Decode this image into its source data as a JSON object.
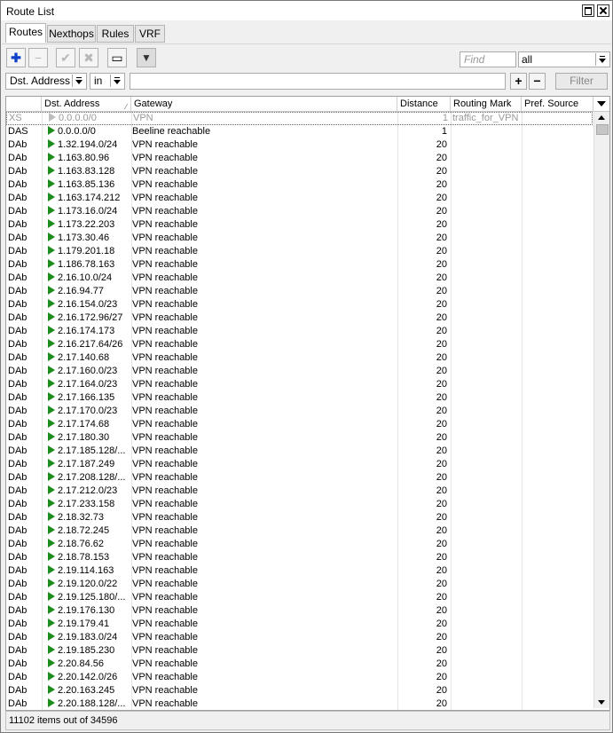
{
  "window": {
    "title": "Route List"
  },
  "tabs": [
    {
      "label": "Routes",
      "active": true
    },
    {
      "label": "Nexthops",
      "active": false
    },
    {
      "label": "Rules",
      "active": false
    },
    {
      "label": "VRF",
      "active": false
    }
  ],
  "toolbar": {
    "buttons": [
      {
        "icon": "plus-icon",
        "glyph": "✚",
        "enabled": true
      },
      {
        "icon": "minus-icon",
        "glyph": "−",
        "enabled": false
      },
      {
        "icon": "check-icon",
        "glyph": "✔",
        "enabled": false
      },
      {
        "icon": "cross-icon",
        "glyph": "✖",
        "enabled": false
      },
      {
        "icon": "comment-icon",
        "glyph": "▭",
        "enabled": true
      },
      {
        "icon": "filter-icon",
        "glyph": "▼",
        "enabled": true
      }
    ],
    "find_placeholder": "Find",
    "scope_value": "all"
  },
  "filter": {
    "field": "Dst. Address",
    "operator": "in",
    "value": "",
    "add_label": "+",
    "remove_label": "−",
    "button_label": "Filter"
  },
  "columns": {
    "flags": "",
    "dst": "Dst. Address",
    "gateway": "Gateway",
    "distance": "Distance",
    "routing_mark": "Routing Mark",
    "pref_source": "Pref. Source"
  },
  "rows": [
    {
      "flags": "XS",
      "dst": "0.0.0.0/0",
      "gateway": "VPN",
      "distance": "1",
      "mark": "traffic_for_VPN",
      "pref": "",
      "disabled": true,
      "selected": true
    },
    {
      "flags": "DAS",
      "dst": "0.0.0.0/0",
      "gateway": "Beeline reachable",
      "distance": "1",
      "mark": "",
      "pref": ""
    },
    {
      "flags": "DAb",
      "dst": "1.32.194.0/24",
      "gateway": "VPN reachable",
      "distance": "20",
      "mark": "",
      "pref": ""
    },
    {
      "flags": "DAb",
      "dst": "1.163.80.96",
      "gateway": "VPN reachable",
      "distance": "20",
      "mark": "",
      "pref": ""
    },
    {
      "flags": "DAb",
      "dst": "1.163.83.128",
      "gateway": "VPN reachable",
      "distance": "20",
      "mark": "",
      "pref": ""
    },
    {
      "flags": "DAb",
      "dst": "1.163.85.136",
      "gateway": "VPN reachable",
      "distance": "20",
      "mark": "",
      "pref": ""
    },
    {
      "flags": "DAb",
      "dst": "1.163.174.212",
      "gateway": "VPN reachable",
      "distance": "20",
      "mark": "",
      "pref": ""
    },
    {
      "flags": "DAb",
      "dst": "1.173.16.0/24",
      "gateway": "VPN reachable",
      "distance": "20",
      "mark": "",
      "pref": ""
    },
    {
      "flags": "DAb",
      "dst": "1.173.22.203",
      "gateway": "VPN reachable",
      "distance": "20",
      "mark": "",
      "pref": ""
    },
    {
      "flags": "DAb",
      "dst": "1.173.30.46",
      "gateway": "VPN reachable",
      "distance": "20",
      "mark": "",
      "pref": ""
    },
    {
      "flags": "DAb",
      "dst": "1.179.201.18",
      "gateway": "VPN reachable",
      "distance": "20",
      "mark": "",
      "pref": ""
    },
    {
      "flags": "DAb",
      "dst": "1.186.78.163",
      "gateway": "VPN reachable",
      "distance": "20",
      "mark": "",
      "pref": ""
    },
    {
      "flags": "DAb",
      "dst": "2.16.10.0/24",
      "gateway": "VPN reachable",
      "distance": "20",
      "mark": "",
      "pref": ""
    },
    {
      "flags": "DAb",
      "dst": "2.16.94.77",
      "gateway": "VPN reachable",
      "distance": "20",
      "mark": "",
      "pref": ""
    },
    {
      "flags": "DAb",
      "dst": "2.16.154.0/23",
      "gateway": "VPN reachable",
      "distance": "20",
      "mark": "",
      "pref": ""
    },
    {
      "flags": "DAb",
      "dst": "2.16.172.96/27",
      "gateway": "VPN reachable",
      "distance": "20",
      "mark": "",
      "pref": ""
    },
    {
      "flags": "DAb",
      "dst": "2.16.174.173",
      "gateway": "VPN reachable",
      "distance": "20",
      "mark": "",
      "pref": ""
    },
    {
      "flags": "DAb",
      "dst": "2.16.217.64/26",
      "gateway": "VPN reachable",
      "distance": "20",
      "mark": "",
      "pref": ""
    },
    {
      "flags": "DAb",
      "dst": "2.17.140.68",
      "gateway": "VPN reachable",
      "distance": "20",
      "mark": "",
      "pref": ""
    },
    {
      "flags": "DAb",
      "dst": "2.17.160.0/23",
      "gateway": "VPN reachable",
      "distance": "20",
      "mark": "",
      "pref": ""
    },
    {
      "flags": "DAb",
      "dst": "2.17.164.0/23",
      "gateway": "VPN reachable",
      "distance": "20",
      "mark": "",
      "pref": ""
    },
    {
      "flags": "DAb",
      "dst": "2.17.166.135",
      "gateway": "VPN reachable",
      "distance": "20",
      "mark": "",
      "pref": ""
    },
    {
      "flags": "DAb",
      "dst": "2.17.170.0/23",
      "gateway": "VPN reachable",
      "distance": "20",
      "mark": "",
      "pref": ""
    },
    {
      "flags": "DAb",
      "dst": "2.17.174.68",
      "gateway": "VPN reachable",
      "distance": "20",
      "mark": "",
      "pref": ""
    },
    {
      "flags": "DAb",
      "dst": "2.17.180.30",
      "gateway": "VPN reachable",
      "distance": "20",
      "mark": "",
      "pref": ""
    },
    {
      "flags": "DAb",
      "dst": "2.17.185.128/...",
      "gateway": "VPN reachable",
      "distance": "20",
      "mark": "",
      "pref": ""
    },
    {
      "flags": "DAb",
      "dst": "2.17.187.249",
      "gateway": "VPN reachable",
      "distance": "20",
      "mark": "",
      "pref": ""
    },
    {
      "flags": "DAb",
      "dst": "2.17.208.128/...",
      "gateway": "VPN reachable",
      "distance": "20",
      "mark": "",
      "pref": ""
    },
    {
      "flags": "DAb",
      "dst": "2.17.212.0/23",
      "gateway": "VPN reachable",
      "distance": "20",
      "mark": "",
      "pref": ""
    },
    {
      "flags": "DAb",
      "dst": "2.17.233.158",
      "gateway": "VPN reachable",
      "distance": "20",
      "mark": "",
      "pref": ""
    },
    {
      "flags": "DAb",
      "dst": "2.18.32.73",
      "gateway": "VPN reachable",
      "distance": "20",
      "mark": "",
      "pref": ""
    },
    {
      "flags": "DAb",
      "dst": "2.18.72.245",
      "gateway": "VPN reachable",
      "distance": "20",
      "mark": "",
      "pref": ""
    },
    {
      "flags": "DAb",
      "dst": "2.18.76.62",
      "gateway": "VPN reachable",
      "distance": "20",
      "mark": "",
      "pref": ""
    },
    {
      "flags": "DAb",
      "dst": "2.18.78.153",
      "gateway": "VPN reachable",
      "distance": "20",
      "mark": "",
      "pref": ""
    },
    {
      "flags": "DAb",
      "dst": "2.19.114.163",
      "gateway": "VPN reachable",
      "distance": "20",
      "mark": "",
      "pref": ""
    },
    {
      "flags": "DAb",
      "dst": "2.19.120.0/22",
      "gateway": "VPN reachable",
      "distance": "20",
      "mark": "",
      "pref": ""
    },
    {
      "flags": "DAb",
      "dst": "2.19.125.180/...",
      "gateway": "VPN reachable",
      "distance": "20",
      "mark": "",
      "pref": ""
    },
    {
      "flags": "DAb",
      "dst": "2.19.176.130",
      "gateway": "VPN reachable",
      "distance": "20",
      "mark": "",
      "pref": ""
    },
    {
      "flags": "DAb",
      "dst": "2.19.179.41",
      "gateway": "VPN reachable",
      "distance": "20",
      "mark": "",
      "pref": ""
    },
    {
      "flags": "DAb",
      "dst": "2.19.183.0/24",
      "gateway": "VPN reachable",
      "distance": "20",
      "mark": "",
      "pref": ""
    },
    {
      "flags": "DAb",
      "dst": "2.19.185.230",
      "gateway": "VPN reachable",
      "distance": "20",
      "mark": "",
      "pref": ""
    },
    {
      "flags": "DAb",
      "dst": "2.20.84.56",
      "gateway": "VPN reachable",
      "distance": "20",
      "mark": "",
      "pref": ""
    },
    {
      "flags": "DAb",
      "dst": "2.20.142.0/26",
      "gateway": "VPN reachable",
      "distance": "20",
      "mark": "",
      "pref": ""
    },
    {
      "flags": "DAb",
      "dst": "2.20.163.245",
      "gateway": "VPN reachable",
      "distance": "20",
      "mark": "",
      "pref": ""
    },
    {
      "flags": "DAb",
      "dst": "2.20.188.128/...",
      "gateway": "VPN reachable",
      "distance": "20",
      "mark": "",
      "pref": ""
    }
  ],
  "status": {
    "text": "11102 items out of 34596"
  },
  "colors": {
    "flag_active": "#1c8c1c",
    "flag_disabled": "#bdbdbd",
    "accent_plus": "#1040c8"
  }
}
